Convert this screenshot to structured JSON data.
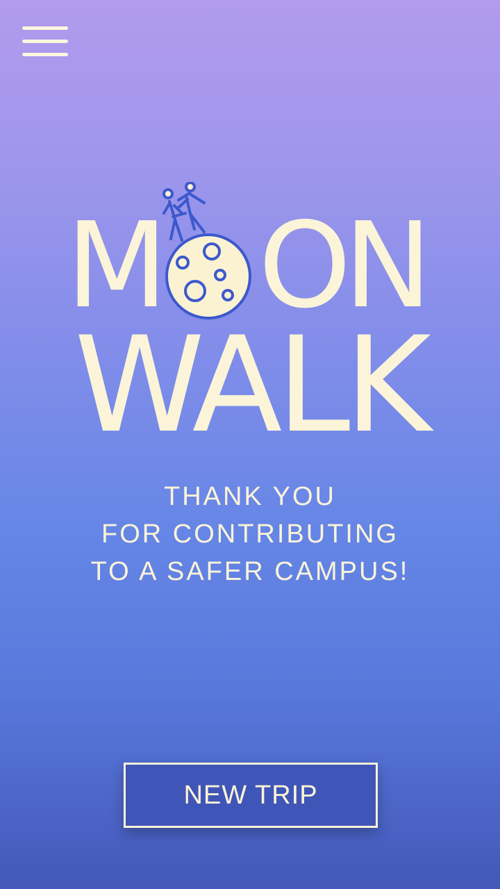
{
  "header": {
    "menu_icon": "hamburger-menu-icon"
  },
  "logo": {
    "line1_left": "M",
    "line1_right": "O",
    "line1_end": "N",
    "line2": "WALK",
    "moon_icon": "moon-walkers-icon",
    "colors": {
      "text": "#fbf4d8",
      "moon_fill": "#fbf2d2",
      "moon_stroke": "#3c59cc"
    }
  },
  "message": {
    "lines": [
      "THANK YOU",
      "FOR CONTRIBUTING",
      "TO A SAFER CAMPUS!"
    ]
  },
  "actions": {
    "new_trip_label": "NEW TRIP"
  }
}
